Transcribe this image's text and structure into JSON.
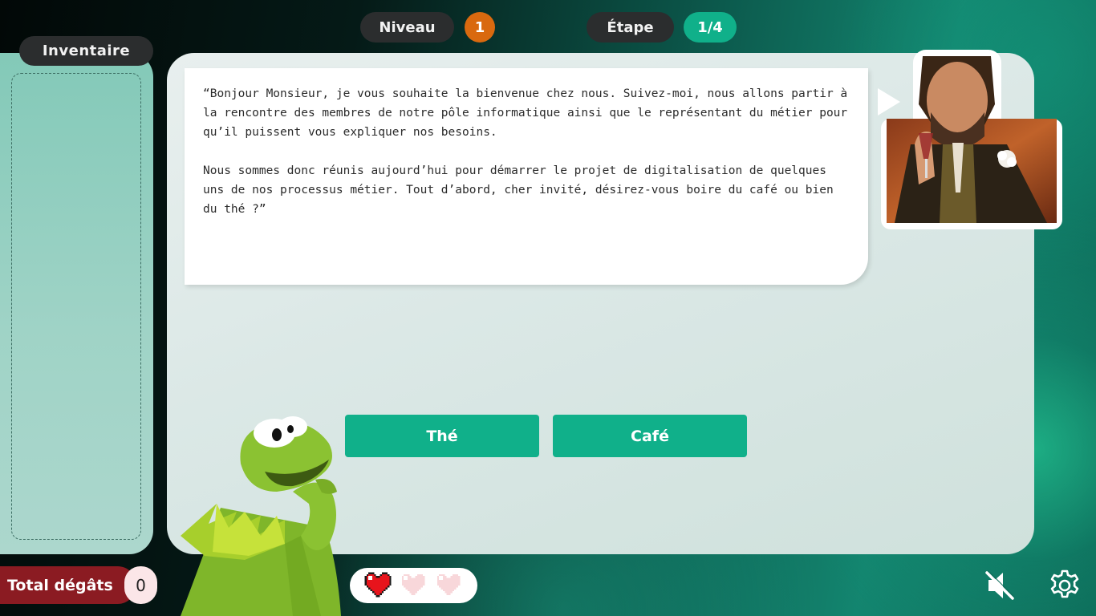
{
  "hud": {
    "level_label": "Niveau",
    "level_value": "1",
    "step_label": "Étape",
    "step_value": "1/4"
  },
  "inventory": {
    "title": "Inventaire"
  },
  "dialog": {
    "paragraphs": [
      "“Bonjour Monsieur, je vous souhaite la bienvenue chez nous. Suivez-moi, nous allons partir à la rencontre des membres de notre pôle informatique ainsi que le représentant du métier pour qu’il puissent vous expliquer nos besoins.",
      "Nous sommes donc réunis aujourd’hui pour démarrer le projet de digitalisation de quelques uns de nos processus métier. Tout d’abord, cher invité, désirez-vous boire du café ou bien du thé ?”"
    ]
  },
  "choices": [
    {
      "label": "Thé"
    },
    {
      "label": "Café"
    }
  ],
  "damage": {
    "label": "Total dégâts",
    "value": "0"
  },
  "lives": {
    "total": 3,
    "remaining": 1
  },
  "colors": {
    "accent": "#10b08a",
    "level_badge": "#d9690f",
    "damage": "#8b1b22",
    "pill_dark": "#2b2d2e"
  },
  "icons": {
    "mute": "speaker-muted-icon",
    "settings": "gear-icon",
    "heart_full": "heart-full-icon",
    "heart_empty": "heart-empty-icon"
  }
}
